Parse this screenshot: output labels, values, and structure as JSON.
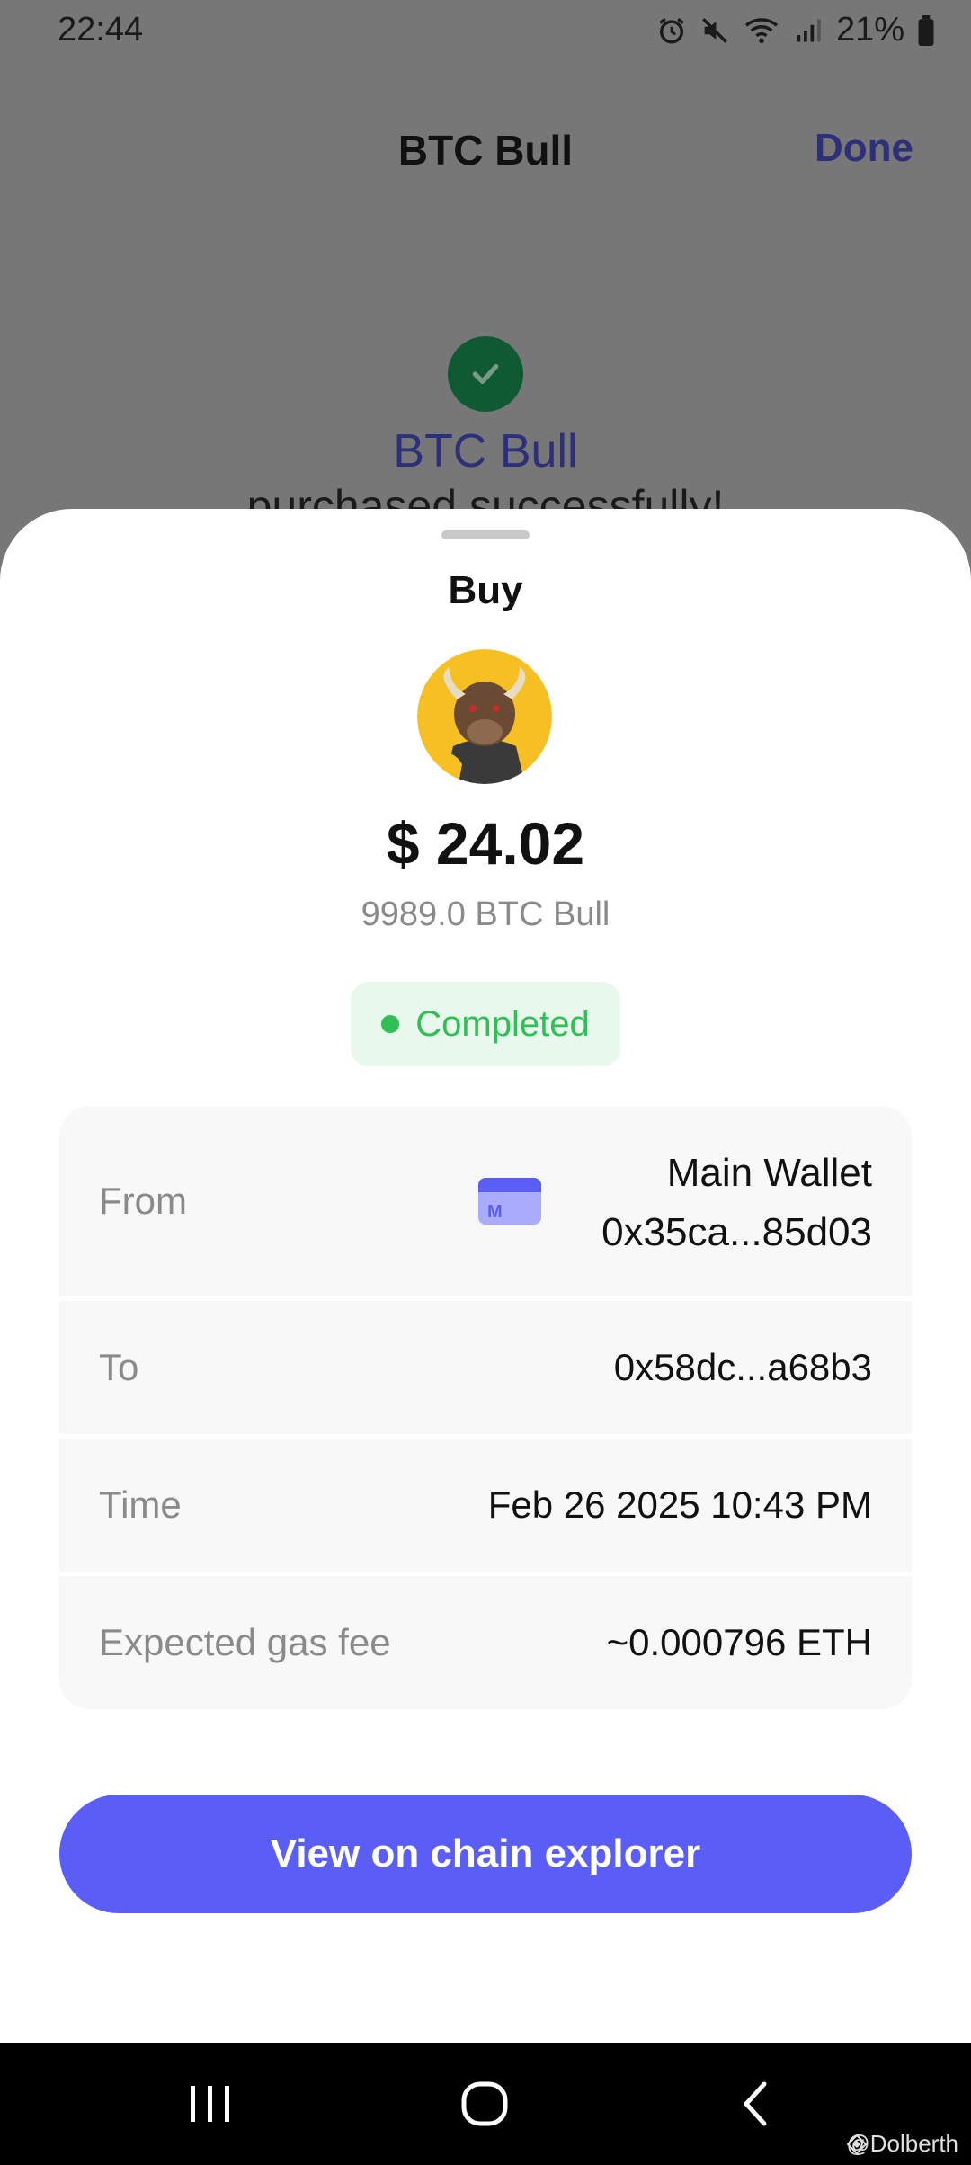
{
  "status_bar": {
    "time": "22:44",
    "battery": "21%"
  },
  "background": {
    "title": "BTC Bull",
    "done": "Done",
    "token_name": "BTC Bull",
    "message": "purchased successfully!"
  },
  "sheet": {
    "title": "Buy",
    "amount": "$ 24.02",
    "token_amount": "9989.0 BTC Bull",
    "status": "Completed",
    "rows": {
      "from": {
        "label": "From",
        "wallet_name": "Main Wallet",
        "address": "0x35ca...85d03"
      },
      "to": {
        "label": "To",
        "value": "0x58dc...a68b3"
      },
      "time": {
        "label": "Time",
        "value": "Feb 26 2025 10:43 PM"
      },
      "gas": {
        "label": "Expected gas fee",
        "value": "~0.000796 ETH"
      }
    },
    "button": "View on chain explorer"
  },
  "watermark": "@Dolberth",
  "colors": {
    "accent": "#5b5ef5",
    "success": "#2fbf55",
    "done": "#2e2f7a"
  }
}
